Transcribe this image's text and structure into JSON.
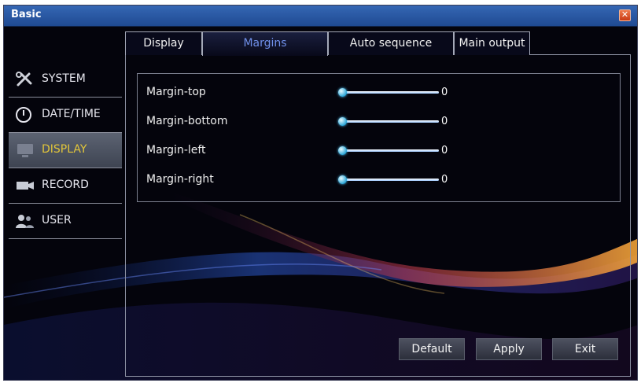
{
  "window": {
    "title": "Basic",
    "close_icon": "close-icon"
  },
  "sidebar": {
    "items": [
      {
        "label": "SYSTEM",
        "icon": "tools-icon",
        "active": false
      },
      {
        "label": "DATE/TIME",
        "icon": "clock-icon",
        "active": false
      },
      {
        "label": "DISPLAY",
        "icon": "monitor-icon",
        "active": true
      },
      {
        "label": "RECORD",
        "icon": "camera-icon",
        "active": false
      },
      {
        "label": "USER",
        "icon": "users-icon",
        "active": false
      }
    ]
  },
  "tabs": [
    {
      "label": "Display",
      "active": false
    },
    {
      "label": "Margins",
      "active": true
    },
    {
      "label": "Auto sequence",
      "active": false
    },
    {
      "label": "Main output",
      "active": false
    }
  ],
  "margins": [
    {
      "label": "Margin-top",
      "value": "0",
      "level": 0
    },
    {
      "label": "Margin-bottom",
      "value": "0",
      "level": 0
    },
    {
      "label": "Margin-left",
      "value": "0",
      "level": 0
    },
    {
      "label": "Margin-right",
      "value": "0",
      "level": 0
    }
  ],
  "buttons": {
    "default_label": "Default",
    "apply_label": "Apply",
    "exit_label": "Exit"
  },
  "colors": {
    "background": "#04040c",
    "titlebar": "#2a5aa8",
    "active_nav_text": "#e2c63a",
    "active_tab_text": "#6f8fe8",
    "slider": "#2aa6d8"
  }
}
